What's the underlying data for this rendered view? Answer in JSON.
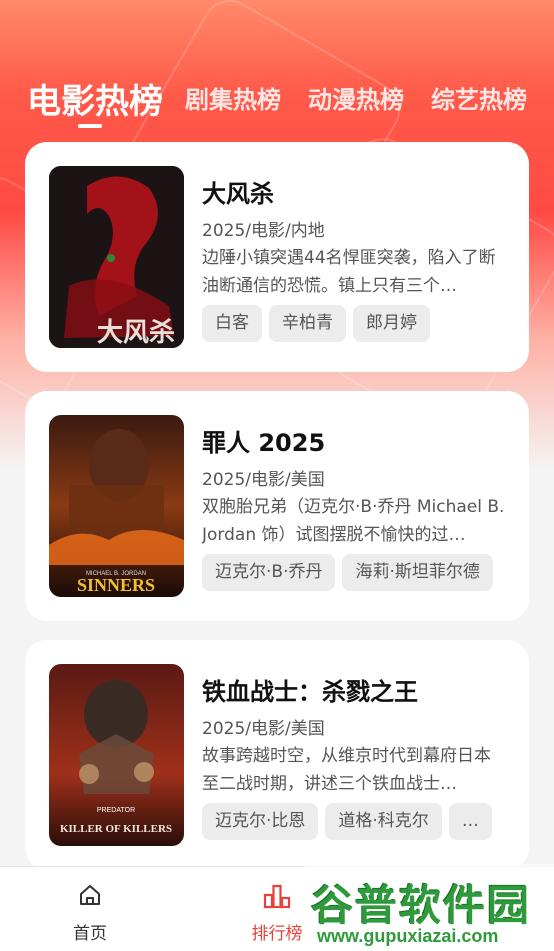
{
  "tabs": [
    {
      "label": "电影热榜",
      "active": true
    },
    {
      "label": "剧集热榜",
      "active": false
    },
    {
      "label": "动漫热榜",
      "active": false
    },
    {
      "label": "综艺热榜",
      "active": false
    }
  ],
  "cards": [
    {
      "title": "大风杀",
      "meta": "2025/电影/内地",
      "desc": "边陲小镇突遇44名悍匪突袭，陷入了断油断通信的恐慌。镇上只有三个…",
      "tags": [
        "白客",
        "辛柏青",
        "郎月婷"
      ],
      "poster_text": "大风杀"
    },
    {
      "title": "罪人 2025",
      "meta": "2025/电影/美国",
      "desc": "双胞胎兄弟（迈克尔·B·乔丹 Michael B. Jordan 饰）试图摆脱不愉快的过…",
      "tags": [
        "迈克尔·B·乔丹",
        "海莉·斯坦菲尔德"
      ],
      "poster_top": "MICHAEL B. JORDAN",
      "poster_title": "SINNERS"
    },
    {
      "title": "铁血战士：杀戮之王",
      "meta": "2025/电影/美国",
      "desc": "故事跨越时空，从维京时代到幕府日本至二战时期，讲述三个铁血战士…",
      "tags": [
        "迈克尔·比恩",
        "道格·科克尔",
        "…"
      ],
      "poster_top": "PREDATOR",
      "poster_title": "KILLER OF KILLERS"
    }
  ],
  "nav": [
    {
      "label": "首页",
      "icon": "home-icon",
      "active": false
    },
    {
      "label": "排行榜",
      "icon": "chart-bar-icon",
      "active": true
    }
  ],
  "watermark": {
    "text": "谷普软件园",
    "url": "www.gupuxiazai.com"
  },
  "colors": {
    "accent": "#e8403a",
    "hero": "#ff4a44",
    "watermark": "#2e9a3c"
  }
}
